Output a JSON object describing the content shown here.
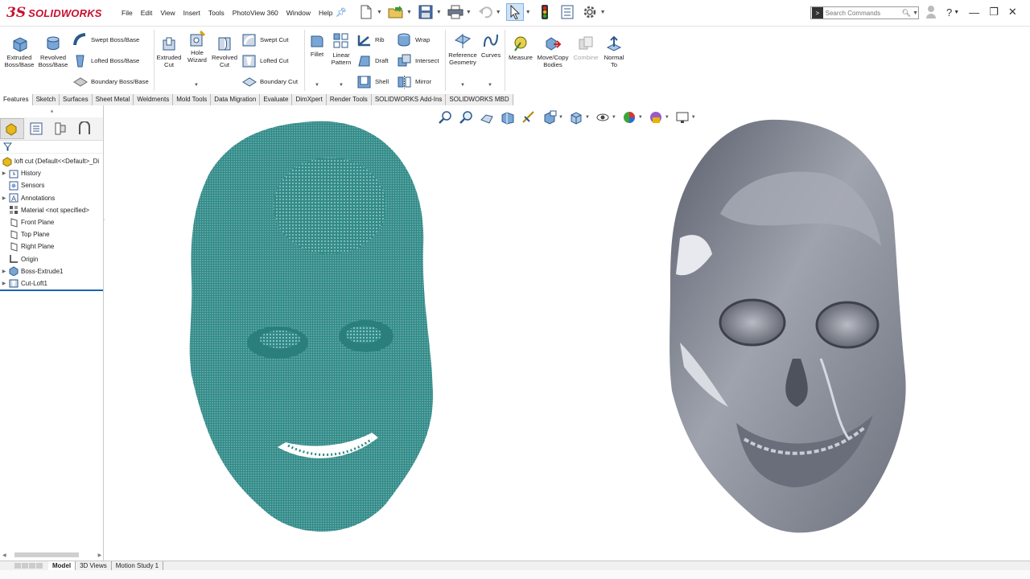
{
  "app": {
    "brand_mark": "3S",
    "brand_name": "SOLIDWORKS"
  },
  "menu": [
    "File",
    "Edit",
    "View",
    "Insert",
    "Tools",
    "PhotoView 360",
    "Window",
    "Help"
  ],
  "search": {
    "placeholder": "Search Commands"
  },
  "ribbon": {
    "extruded_boss": "Extruded Boss/Base",
    "revolved_boss": "Revolved Boss/Base",
    "swept_boss": "Swept Boss/Base",
    "lofted_boss": "Lofted Boss/Base",
    "boundary_boss": "Boundary Boss/Base",
    "extruded_cut": "Extruded Cut",
    "hole_wizard": "Hole Wizard",
    "revolved_cut": "Revolved Cut",
    "swept_cut": "Swept Cut",
    "lofted_cut": "Lofted Cut",
    "boundary_cut": "Boundary Cut",
    "fillet": "Fillet",
    "linear_pattern": "Linear Pattern",
    "rib": "Rib",
    "draft": "Draft",
    "shell": "Shell",
    "wrap": "Wrap",
    "intersect": "Intersect",
    "mirror": "Mirror",
    "reference_geometry": "Reference Geometry",
    "curves": "Curves",
    "measure": "Measure",
    "move_copy": "Move/Copy Bodies",
    "combine": "Combine",
    "normal_to": "Normal To"
  },
  "tabs": [
    "Features",
    "Sketch",
    "Surfaces",
    "Sheet Metal",
    "Weldments",
    "Mold Tools",
    "Data Migration",
    "Evaluate",
    "DimXpert",
    "Render Tools",
    "SOLIDWORKS Add-Ins",
    "SOLIDWORKS MBD"
  ],
  "tree": {
    "root": "loft cut  (Default<<Default>_Di",
    "items": [
      "History",
      "Sensors",
      "Annotations",
      "Material <not specified>",
      "Front Plane",
      "Top Plane",
      "Right Plane",
      "Origin",
      "Boss-Extrude1",
      "Cut-Loft1"
    ]
  },
  "bottom_tabs": [
    "Model",
    "3D Views",
    "Motion Study 1"
  ],
  "colors": {
    "brand_red": "#c8102e",
    "point_cloud": "#2f8a87",
    "mesh_gray": "#8a8d96",
    "tree_accent": "#1a63b3"
  }
}
